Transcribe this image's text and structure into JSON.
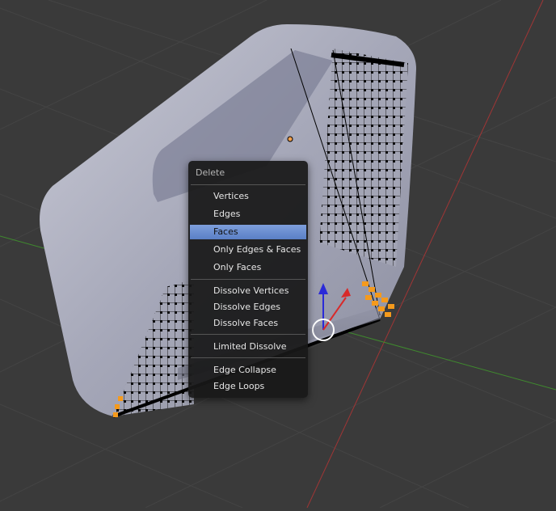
{
  "menu": {
    "title": "Delete",
    "items": [
      {
        "label": "Vertices",
        "key": "V",
        "active": false
      },
      {
        "label": "Edges",
        "key": "E",
        "active": false
      },
      {
        "label": "Faces",
        "key": "F",
        "active": true
      },
      {
        "label": "Only Edges & Faces",
        "key": "O",
        "active": false
      },
      {
        "label": "Only Faces",
        "key": "n",
        "active": false
      },
      {
        "label": "Dissolve Vertices",
        "key": "D",
        "active": false
      },
      {
        "label": "Dissolve Edges",
        "key": "i",
        "active": false
      },
      {
        "label": "Dissolve Faces",
        "key": "s",
        "active": false
      },
      {
        "label": "Limited Dissolve",
        "key": "L",
        "active": false
      },
      {
        "label": "Edge Collapse",
        "key": "l",
        "active": false
      },
      {
        "label": "Edge Loops",
        "key": "p",
        "active": false
      }
    ]
  },
  "colors": {
    "viewport_background": "#3a3a3a",
    "grid_line": "#444444",
    "x_axis": "#a03535",
    "y_axis": "#3f8a2e",
    "mesh_surface": "#9d9fb0",
    "mesh_wire": "#111111",
    "selected_vertex": "#f59a1c",
    "menu_background": "#181818",
    "menu_highlight": "#6d8fd3"
  }
}
